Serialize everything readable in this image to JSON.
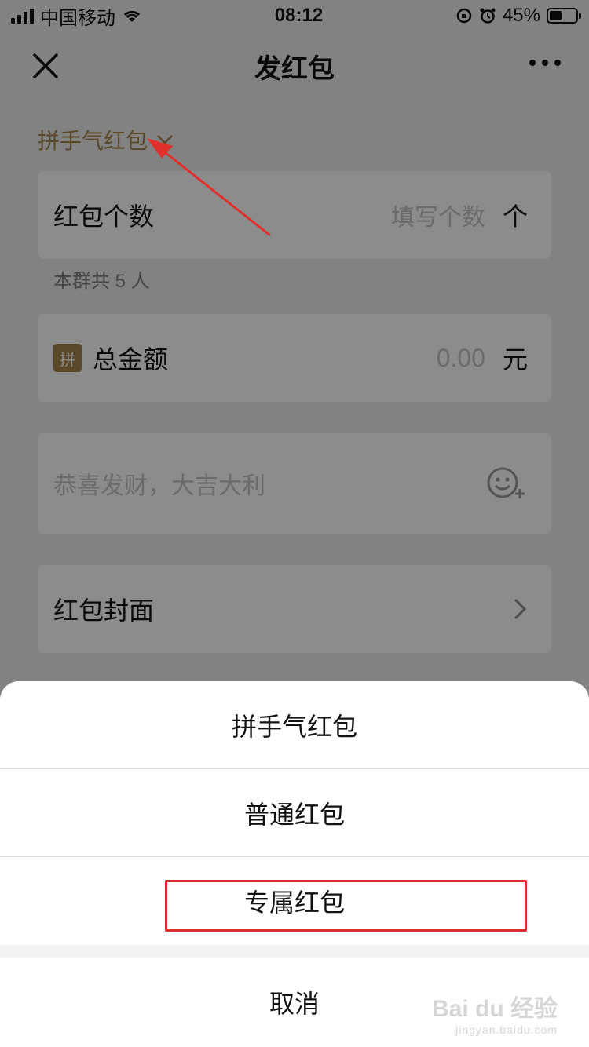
{
  "status_bar": {
    "carrier": "中国移动",
    "time": "08:12",
    "battery_text": "45%"
  },
  "nav": {
    "title": "发红包"
  },
  "type_switch": {
    "label": "拼手气红包"
  },
  "count_card": {
    "label": "红包个数",
    "placeholder": "填写个数",
    "unit": "个"
  },
  "group_hint": "本群共 5 人",
  "amount_card": {
    "badge": "拼",
    "label": "总金额",
    "placeholder": "0.00",
    "unit": "元"
  },
  "greeting_card": {
    "placeholder": "恭喜发财，大吉大利"
  },
  "cover_card": {
    "label": "红包封面"
  },
  "action_sheet": {
    "options": [
      "拼手气红包",
      "普通红包",
      "专属红包"
    ],
    "cancel": "取消"
  },
  "watermark": {
    "brand": "Bai du 经验",
    "url": "jingyan.baidu.com"
  },
  "colors": {
    "accent_gold": "#a4834b",
    "annotation_red": "#d9302d"
  }
}
